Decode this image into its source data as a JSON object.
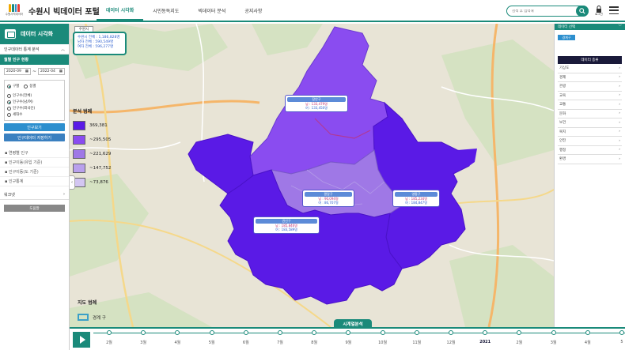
{
  "header": {
    "logo_caption": "수원시빅데이터",
    "title": "수원시 빅데이터 포털",
    "nav": [
      "데이터 시각화",
      "시민동독지도",
      "빅데이터 분석",
      "공지사항"
    ],
    "search_placeholder": "검색 후 입력해",
    "login_label": "로그인"
  },
  "sidebar": {
    "heading": "데이터 시각화",
    "section": "인구데이터 통계 분석",
    "subsection": "월별 인구 현황",
    "date_from": "2020-09",
    "date_to": "2022-04",
    "unit_options": [
      "구별",
      "동별"
    ],
    "type_options": [
      "인구수(전체)",
      "인구수(남/여)",
      "인구수(외국인)",
      "세대수"
    ],
    "btn_view": "인구보기",
    "btn_download": "인구데이터 저장하기",
    "links": [
      "연령별 인구",
      "인구이동(유입 기준)",
      "인구이동(도 기준)",
      "인구통계"
    ],
    "worknet": "워크넷",
    "gray_btn": "도움말"
  },
  "map": {
    "mini_tag": "수원시",
    "info_lines": [
      "수원시 전체 : 1,186,828명",
      "남자 전체 : 590,549명",
      "여자 전체 : 596,277명"
    ],
    "legend_title": "분석 범례",
    "legend": [
      {
        "label": "369,381",
        "color": "#5a1ae6"
      },
      {
        "label": "~295,505",
        "color": "#8a4cf0"
      },
      {
        "label": "~221,629",
        "color": "#9f78e6"
      },
      {
        "label": "~147,752",
        "color": "#b9a0ec"
      },
      {
        "label": "~73,876",
        "color": "#d3c6f2"
      }
    ],
    "tooltips": [
      {
        "name": "장안구",
        "m": "남 : 133,479명",
        "f": "여 : 133,450명"
      },
      {
        "name": "팔달구",
        "m": "남 : 90,094명",
        "f": "여 : 86,707명"
      },
      {
        "name": "영통구",
        "m": "남 : 185,234명",
        "f": "여 : 184,847명"
      },
      {
        "name": "권선구",
        "m": "남 : 185,846명",
        "f": "여 : 183,589명"
      }
    ],
    "map_legend_title": "지도 범례",
    "map_legend_item": "경계 구"
  },
  "right_panel": {
    "heading": "데이터 선택",
    "tag": "경계구",
    "category_title": "데이터 종류",
    "items": [
      "기상도",
      "경제",
      "관광",
      "교육",
      "교통",
      "문화",
      "보건",
      "복지",
      "안전",
      "행정",
      "환경"
    ]
  },
  "timeline": {
    "tab": "시계열분석",
    "ticks": [
      "2월",
      "3월",
      "4월",
      "5월",
      "6월",
      "7월",
      "8월",
      "9월",
      "10월",
      "11월",
      "12월",
      "2021",
      "2월",
      "3월",
      "4월",
      "5"
    ]
  },
  "colors": {
    "accent": "#1a8a7a",
    "district_main": "#5a1ae6",
    "district_light": "#8a4cf0"
  }
}
